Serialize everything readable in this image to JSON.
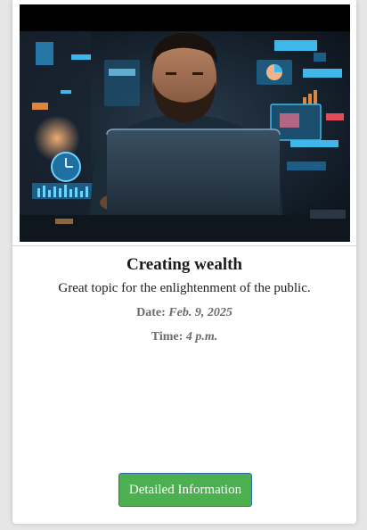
{
  "event_card": {
    "image_alt": "Man working on a laptop surrounded by glowing financial charts",
    "title": "Creating wealth",
    "description": "Great topic for the enlightenment of the public.",
    "date_label": "Date:",
    "date_value": "Feb. 9, 2025",
    "time_label": "Time:",
    "time_value": "4 p.m.",
    "button_label": "Detailed Information"
  },
  "colors": {
    "page_background": "#e6e6e6",
    "card_background": "#ffffff",
    "button_background": "#4caf50",
    "button_border": "#2e6da4",
    "meta_text": "#6b6b6b"
  },
  "icons": [
    "laptop-photo"
  ]
}
